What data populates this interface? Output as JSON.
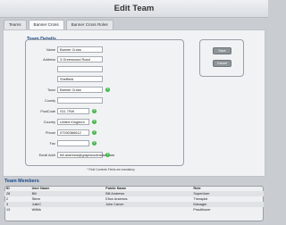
{
  "header": {
    "title": "Edit Team"
  },
  "tabs": [
    {
      "label": "Teams"
    },
    {
      "label": "Banner Cross"
    },
    {
      "label": "Banner Cross Roles"
    }
  ],
  "team_details": {
    "title": "Team Details",
    "fields": [
      {
        "label": "Name",
        "value": "Banner Cross"
      },
      {
        "label": "Address",
        "value": "3 Greenwood Road"
      },
      {
        "label": "",
        "value": ""
      },
      {
        "label": "",
        "value": "Sheffield"
      },
      {
        "label": "Town",
        "value": "Banner Cross"
      },
      {
        "label": "County",
        "value": ""
      },
      {
        "label": "PostCode",
        "value": "S11 7SW"
      },
      {
        "label": "Country",
        "value": "United Kingdom"
      },
      {
        "label": "Phone",
        "value": "07930366612"
      },
      {
        "label": "Fax",
        "value": ""
      },
      {
        "label": "Email Addr",
        "value": "bill.andrews@graphicsxtracker.com"
      }
    ],
    "note": "* Field Contents Fields are mandatory"
  },
  "actions": {
    "save": "Save",
    "cancel": "Cancel"
  },
  "members": {
    "title": "Team Members",
    "columns": [
      "ID",
      "User Name",
      "Public Name",
      "Role"
    ],
    "rows": [
      [
        "28",
        "Bill",
        "Bill Andrews",
        "SuperUser"
      ],
      [
        "2",
        "Steve",
        "Elton Andrews",
        "Therapist"
      ],
      [
        "3",
        "JulieC",
        "Julie Carver",
        "Manager"
      ],
      [
        "13",
        "Wilfrik",
        "",
        "Practitioner"
      ]
    ]
  }
}
